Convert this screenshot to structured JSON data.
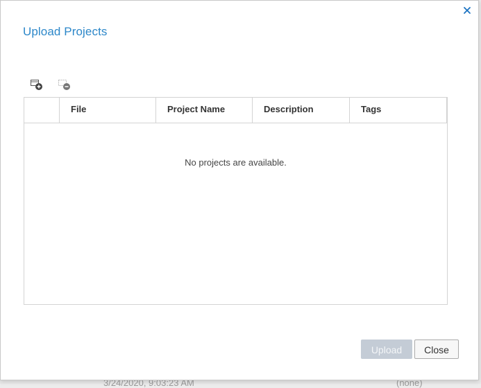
{
  "dialog": {
    "title": "Upload Projects",
    "close_icon": "close-icon"
  },
  "toolbar": {
    "add_icon": "add-row-icon",
    "remove_icon": "remove-row-icon"
  },
  "table": {
    "columns": [
      "",
      "File",
      "Project Name",
      "Description",
      "Tags"
    ],
    "empty_message": "No projects are available."
  },
  "buttons": {
    "upload_label": "Upload",
    "close_label": "Close"
  },
  "background": {
    "timestamp": "3/24/2020, 9:03:23 AM",
    "value": "(none)"
  },
  "colors": {
    "accent": "#2c87c9",
    "close_x": "#1b73c2",
    "upload_disabled": "#c4ccd6"
  }
}
